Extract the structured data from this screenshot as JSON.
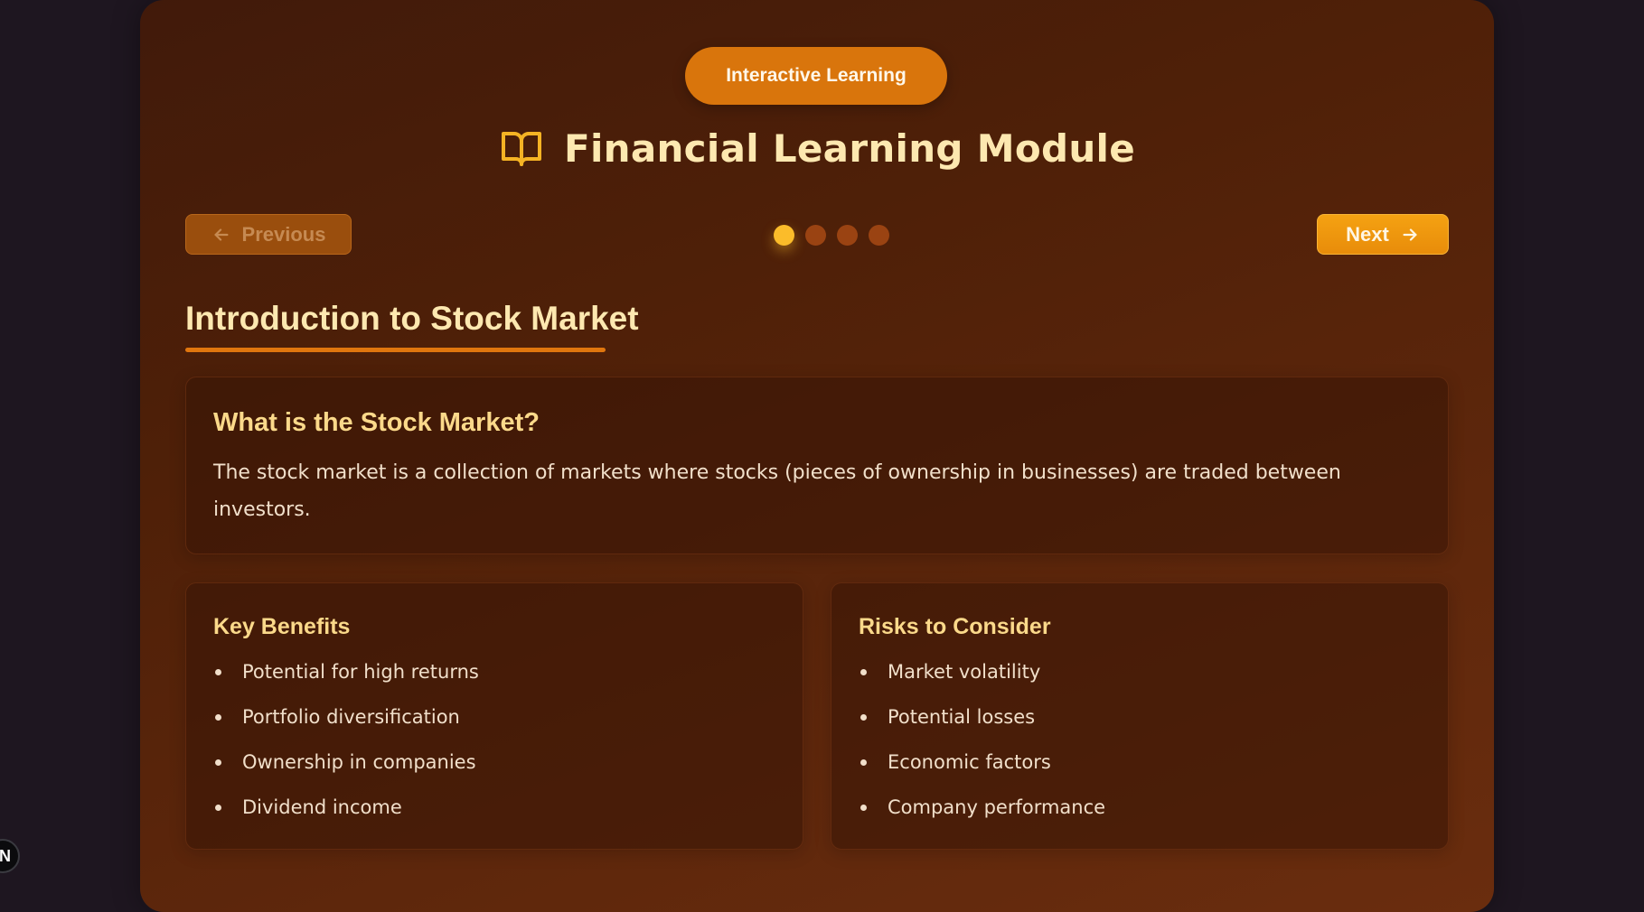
{
  "header": {
    "badge_label": "Interactive Learning",
    "title": "Financial Learning Module",
    "title_icon": "book-open-icon"
  },
  "navigation": {
    "previous_label": "Previous",
    "previous_icon": "arrow-left-icon",
    "next_label": "Next",
    "next_icon": "arrow-right-icon",
    "total_steps": 4,
    "current_step": 1
  },
  "section": {
    "title": "Introduction to Stock Market"
  },
  "intro_card": {
    "heading": "What is the Stock Market?",
    "body": "The stock market is a collection of markets where stocks (pieces of ownership in businesses) are traded between investors."
  },
  "benefits": {
    "heading": "Key Benefits",
    "items": [
      "Potential for high returns",
      "Portfolio diversification",
      "Ownership in companies",
      "Dividend income"
    ]
  },
  "risks": {
    "heading": "Risks to Consider",
    "items": [
      "Market volatility",
      "Potential losses",
      "Economic factors",
      "Company performance"
    ]
  },
  "corner_badge": {
    "label": "N"
  },
  "colors": {
    "accent": "#d9750c",
    "title_text": "#fde8b0",
    "active_dot": "#fbbc2a",
    "inactive_dot": "#9a4312"
  }
}
